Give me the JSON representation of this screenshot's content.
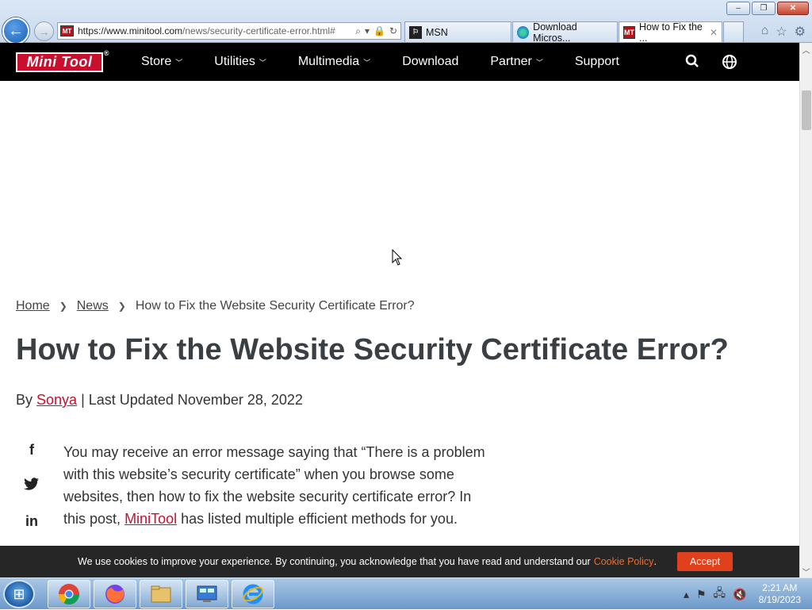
{
  "window": {
    "min": "–",
    "max": "❐",
    "close": "✕"
  },
  "address": {
    "url_main": "https://www.minitool.com",
    "url_rest": "/news/security-certificate-error.html#",
    "favicon": "MT"
  },
  "tabs": [
    {
      "label": "MSN",
      "icon": "msn-icon"
    },
    {
      "label": "Download Micros...",
      "icon": "edge-icon"
    },
    {
      "label": "How to Fix the ...",
      "icon": "minitool-icon",
      "active": true
    }
  ],
  "site": {
    "logo": "Mini Tool",
    "logo_reg": "®",
    "menu": [
      {
        "label": "Store",
        "caret": true
      },
      {
        "label": "Utilities",
        "caret": true
      },
      {
        "label": "Multimedia",
        "caret": true
      },
      {
        "label": "Download",
        "caret": false
      },
      {
        "label": "Partner",
        "caret": true
      },
      {
        "label": "Support",
        "caret": false
      }
    ]
  },
  "breadcrumb": {
    "home": "Home",
    "news": "News",
    "current": "How to Fix the Website Security Certificate Error?"
  },
  "article": {
    "title": "How to Fix the Website Security Certificate Error?",
    "by": "By",
    "author": "Sonya",
    "updated": "| Last Updated November 28, 2022",
    "intro_pre": "You may receive an error message saying that “There is a problem with this website’s security certificate” when you browse some websites, then how to fix the website security certificate error? In this post,",
    "intro_link": "MiniTool",
    "intro_post": "has listed multiple efficient methods for you."
  },
  "share": {
    "facebook": "f",
    "twitter": "🐦",
    "linkedin": "in"
  },
  "cookie": {
    "text": "We use cookies to improve your experience. By continuing, you acknowledge that you have read and understand our",
    "link": "Cookie Policy",
    "period": ".",
    "accept": "Accept"
  },
  "taskbar": {
    "time": "2:21 AM",
    "date": "8/19/2023"
  }
}
